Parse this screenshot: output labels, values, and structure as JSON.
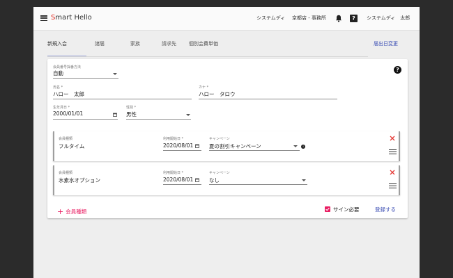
{
  "header": {
    "brand_first": "S",
    "brand_rest": "mart Hello",
    "org_name": "システムディ",
    "store_name": "京都店 - 事務所",
    "user_name": "システムディ　太郎"
  },
  "tabs": [
    "新規入会",
    "諸届",
    "家族",
    "請求先",
    "個別会費単価"
  ],
  "tab_right": "届出日変更",
  "form": {
    "number_method": {
      "label": "会員番号採番方法",
      "value": "自動"
    },
    "name": {
      "label": "氏名 *",
      "value": "ハロー　太郎"
    },
    "kana": {
      "label": "カナ *",
      "value": "ハロー　タロウ"
    },
    "birthdate": {
      "label": "生年月日 *",
      "value": "2000/01/01"
    },
    "gender": {
      "label": "性別 *",
      "value": "男性"
    }
  },
  "courses": [
    {
      "type_label": "会員種類",
      "type_value": "フルタイム",
      "start_label": "利用開始日 *",
      "start_value": "2020/08/01",
      "campaign_label": "キャンペーン",
      "campaign_value": "夏の割引キャンペーン"
    },
    {
      "type_label": "会員種類",
      "type_value": "水素水オプション",
      "start_label": "利用開始日 *",
      "start_value": "2020/08/01",
      "campaign_label": "キャンペーン",
      "campaign_value": "なし"
    }
  ],
  "actions": {
    "add_label": "会員種類",
    "sign_label": "サイン必要",
    "sign_checked": true,
    "save_label": "登録する"
  },
  "colors": {
    "accent_pink": "#e91e63",
    "link_blue": "#3f51b5",
    "delete_red": "#e53935",
    "brand_red": "#e0251b"
  }
}
